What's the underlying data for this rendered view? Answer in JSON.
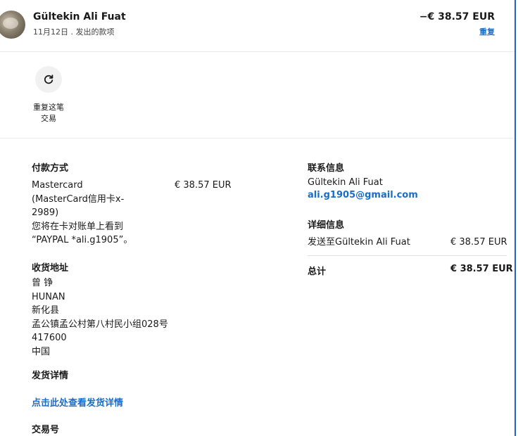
{
  "header": {
    "name": "Gültekin Ali Fuat",
    "subtitle": "11月12日 . 发出的款项",
    "amount": "−€ 38.57 EUR",
    "repeat_link": "重复"
  },
  "repeat_action": {
    "label_line1": "重复这笔",
    "label_line2": "交易",
    "icon": "refresh-icon"
  },
  "payment_method": {
    "title": "付款方式",
    "lines": [
      "Mastercard",
      "(MasterCard信用卡x-",
      "2989)",
      "您将在卡对账单上看到",
      "“PAYPAL *ali.g1905”。"
    ],
    "amount": "€ 38.57 EUR"
  },
  "shipping_address": {
    "title": "收货地址",
    "lines": [
      "曾 铮",
      "HUNAN",
      "新化县",
      "孟公镇孟公村第八村民小组028号",
      "417600",
      "中国"
    ]
  },
  "shipping_details": {
    "title": "发货详情",
    "link": "点击此处查看发货详情"
  },
  "transaction_id": {
    "title": "交易号"
  },
  "contact": {
    "title": "联系信息",
    "name": "Gültekin Ali Fuat",
    "email": "ali.g1905@gmail.com"
  },
  "details": {
    "title": "详细信息",
    "row_label": "发送至Gültekin Ali Fuat",
    "row_amount": "€ 38.57 EUR"
  },
  "total": {
    "label": "总计",
    "amount": "€ 38.57 EUR"
  },
  "colors": {
    "accent_blue": "#1a6cc9",
    "border_blue": "#2a5bd7"
  }
}
